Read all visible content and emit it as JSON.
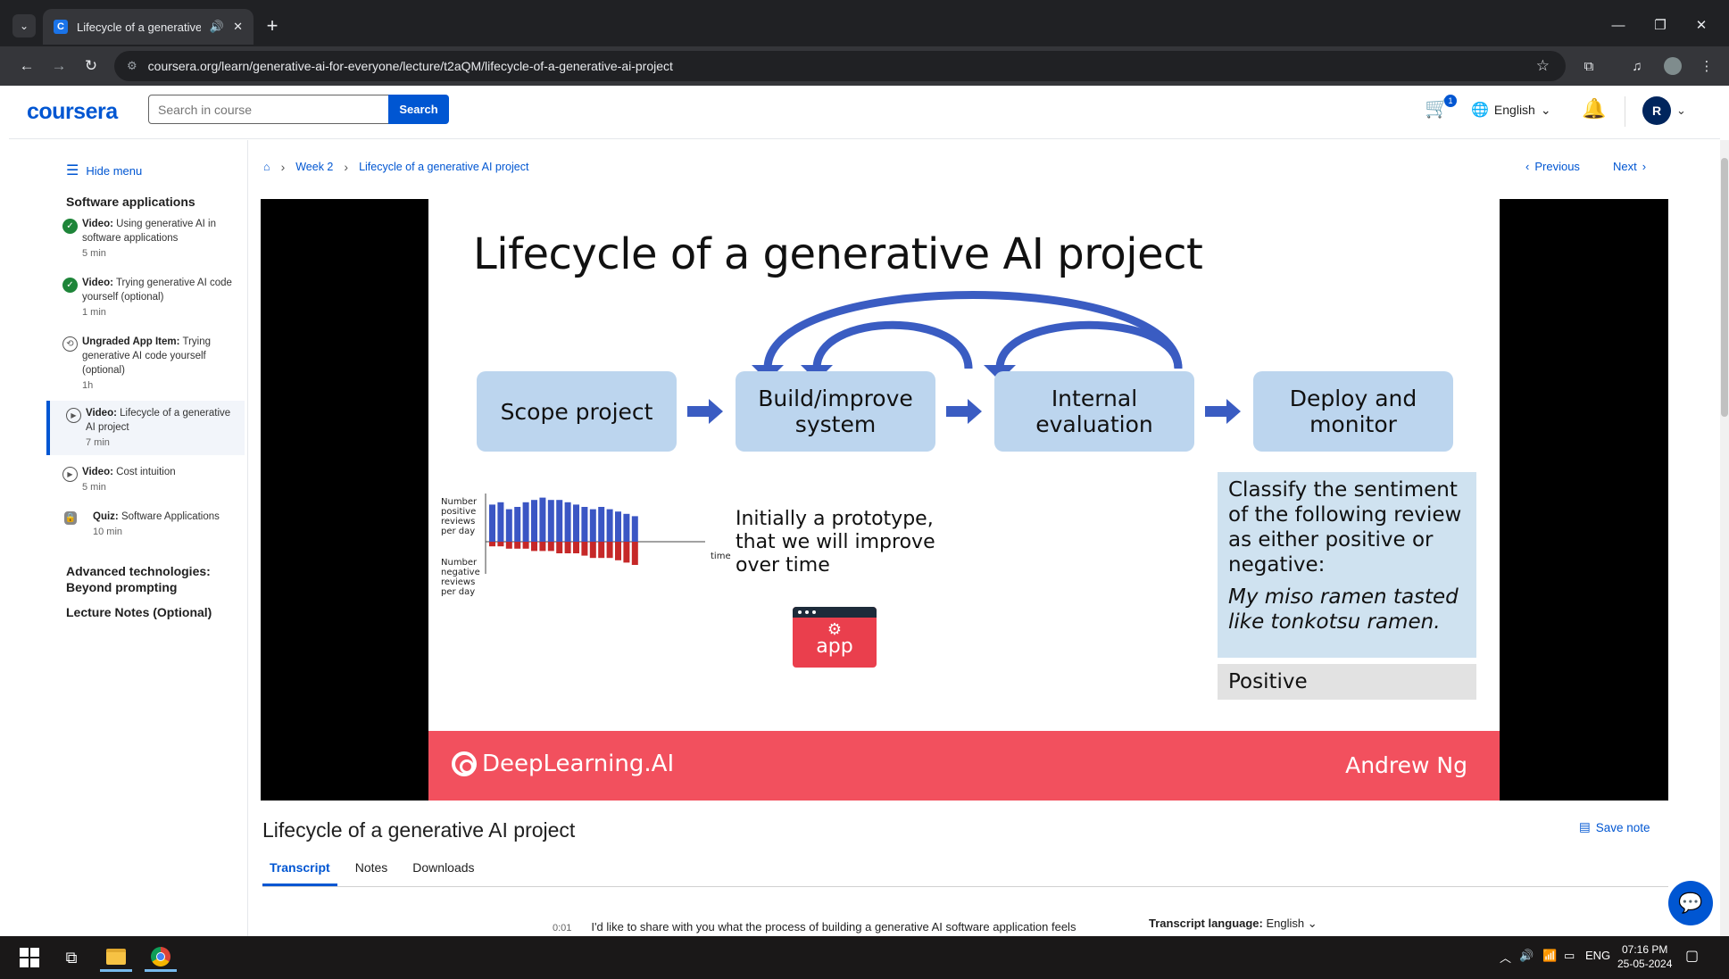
{
  "browser": {
    "tab_title": "Lifecycle of a generative AI",
    "favicon_letter": "C",
    "url": "coursera.org/learn/generative-ai-for-everyone/lecture/t2aQM/lifecycle-of-a-generative-ai-project"
  },
  "header": {
    "logo": "coursera",
    "search_placeholder": "Search in course",
    "search_button": "Search",
    "cart_count": "1",
    "language": "English",
    "avatar_initial": "R"
  },
  "sidebar": {
    "hide_menu": "Hide menu",
    "section_title": "Software applications",
    "items": [
      {
        "type": "Video:",
        "title": "Using generative AI in software applications",
        "duration": "5 min"
      },
      {
        "type": "Video:",
        "title": "Trying generative AI code yourself (optional)",
        "duration": "1 min"
      },
      {
        "type": "Ungraded App Item:",
        "title": "Trying generative AI code yourself (optional)",
        "duration": "1h"
      },
      {
        "type": "Video:",
        "title": "Lifecycle of a generative AI project",
        "duration": "7 min"
      },
      {
        "type": "Video:",
        "title": "Cost intuition",
        "duration": "5 min"
      },
      {
        "type": "Quiz:",
        "title": "Software Applications",
        "duration": "10 min"
      }
    ],
    "section_2": "Advanced technologies: Beyond prompting",
    "section_3": "Lecture Notes (Optional)"
  },
  "breadcrumb": {
    "week": "Week 2",
    "current": "Lifecycle of a generative AI project"
  },
  "pager": {
    "previous": "Previous",
    "next": "Next"
  },
  "slide": {
    "title": "Lifecycle of a generative AI project",
    "stages": [
      "Scope project",
      "Build/improve system",
      "Internal evaluation",
      "Deploy and monitor"
    ],
    "chart_labels": {
      "positive": "Number positive reviews per day",
      "negative": "Number negative reviews per day",
      "axis": "time"
    },
    "prototype_text": "Initially a prototype, that we will improve over time",
    "app_label": "app",
    "prompt_text": "Classify the sentiment of the following review as either positive or negative:",
    "prompt_review": "My miso ramen tasted like tonkotsu ramen.",
    "answer": "Positive",
    "footer_brand": "DeepLearning.AI",
    "footer_author": "Andrew Ng"
  },
  "chart_data": {
    "type": "bar",
    "series": [
      {
        "name": "Number positive reviews per day",
        "values": [
          8,
          8.5,
          7,
          7.5,
          8.5,
          9,
          9.5,
          9,
          9,
          8.5,
          8,
          7.5,
          7,
          7.5,
          7,
          6.5,
          6,
          5.5
        ],
        "color": "#3b56c4"
      },
      {
        "name": "Number negative reviews per day",
        "values": [
          1,
          1,
          1.5,
          1.5,
          1.5,
          2,
          2,
          2,
          2.5,
          2.5,
          2.5,
          3,
          3.5,
          3.5,
          3.5,
          4,
          4.5,
          5
        ],
        "color": "#c62828"
      }
    ],
    "xlabel": "time",
    "title": ""
  },
  "lecture": {
    "title": "Lifecycle of a generative AI project",
    "save_note": "Save note",
    "tabs": [
      "Transcript",
      "Notes",
      "Downloads"
    ],
    "transcript_time": "0:01",
    "transcript_text": "I'd like to share with you what the process of building a generative AI software application feels",
    "transcript_language_label": "Transcript language:",
    "transcript_language": "English"
  },
  "taskbar": {
    "language": "ENG",
    "time": "07:16 PM",
    "date": "25-05-2024"
  },
  "colors": {
    "brand": "#0056d2",
    "stage_fill": "#bcd5ee",
    "footer": "#f2505e"
  }
}
